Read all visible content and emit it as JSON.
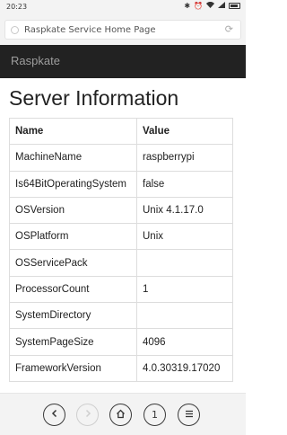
{
  "status_bar": {
    "time": "20:23",
    "icons": [
      "bluetooth-icon",
      "alarm-icon",
      "wifi-icon",
      "signal-icon",
      "battery-icon"
    ]
  },
  "browser": {
    "url_text": "Raspkate Service Home Page",
    "tab_count": "1"
  },
  "navbar": {
    "brand": "Raspkate"
  },
  "page": {
    "title": "Server Information",
    "table": {
      "headers": [
        "Name",
        "Value"
      ],
      "rows": [
        {
          "name": "MachineName",
          "value": "raspberrypi"
        },
        {
          "name": "Is64BitOperatingSystem",
          "value": "false"
        },
        {
          "name": "OSVersion",
          "value": "Unix 4.1.17.0"
        },
        {
          "name": "OSPlatform",
          "value": "Unix"
        },
        {
          "name": "OSServicePack",
          "value": ""
        },
        {
          "name": "ProcessorCount",
          "value": "1"
        },
        {
          "name": "SystemDirectory",
          "value": ""
        },
        {
          "name": "SystemPageSize",
          "value": "4096"
        },
        {
          "name": "FrameworkVersion",
          "value": "4.0.30319.17020"
        }
      ]
    }
  }
}
